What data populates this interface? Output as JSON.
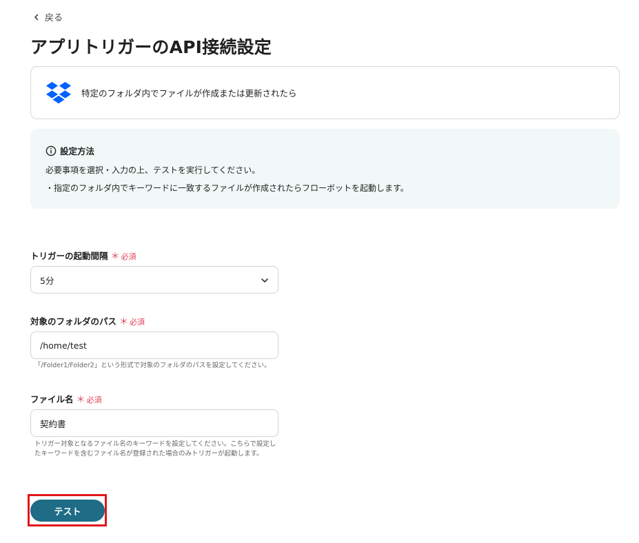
{
  "nav": {
    "back_label": "戻る"
  },
  "page": {
    "title": "アプリトリガーのAPI接続設定"
  },
  "trigger": {
    "app_icon": "dropbox-logo",
    "description": "特定のフォルダ内でファイルが作成または更新されたら"
  },
  "info": {
    "title": "設定方法",
    "lines": [
      "必要事項を選択・入力の上、テストを実行してください。",
      "・指定のフォルダ内でキーワードに一致するファイルが作成されたらフローボットを起動します。"
    ]
  },
  "form": {
    "interval": {
      "label": "トリガーの起動間隔",
      "required_mark": "＊",
      "required_text": "必須",
      "value": "5分"
    },
    "folder_path": {
      "label": "対象のフォルダのパス",
      "required_mark": "＊",
      "required_text": "必須",
      "value": "/home/test",
      "hint": "「/Folder1/Folder2」という形式で対象のフォルダのパスを設定してください。"
    },
    "file_name": {
      "label": "ファイル名",
      "required_mark": "＊",
      "required_text": "必須",
      "value": "契約書",
      "hint_line1": "トリガー対象となるファイル名のキーワードを設定してください。こちらで設定し",
      "hint_line2": "たキーワードを含むファイル名が登録された場合のみトリガーが起動します。"
    }
  },
  "actions": {
    "test_label": "テスト"
  },
  "colors": {
    "accent": "#1e6c85",
    "required": "#e0405a",
    "info_bg": "#f1f8f7",
    "highlight": "#e0171b",
    "dropbox": "#0061fe"
  }
}
